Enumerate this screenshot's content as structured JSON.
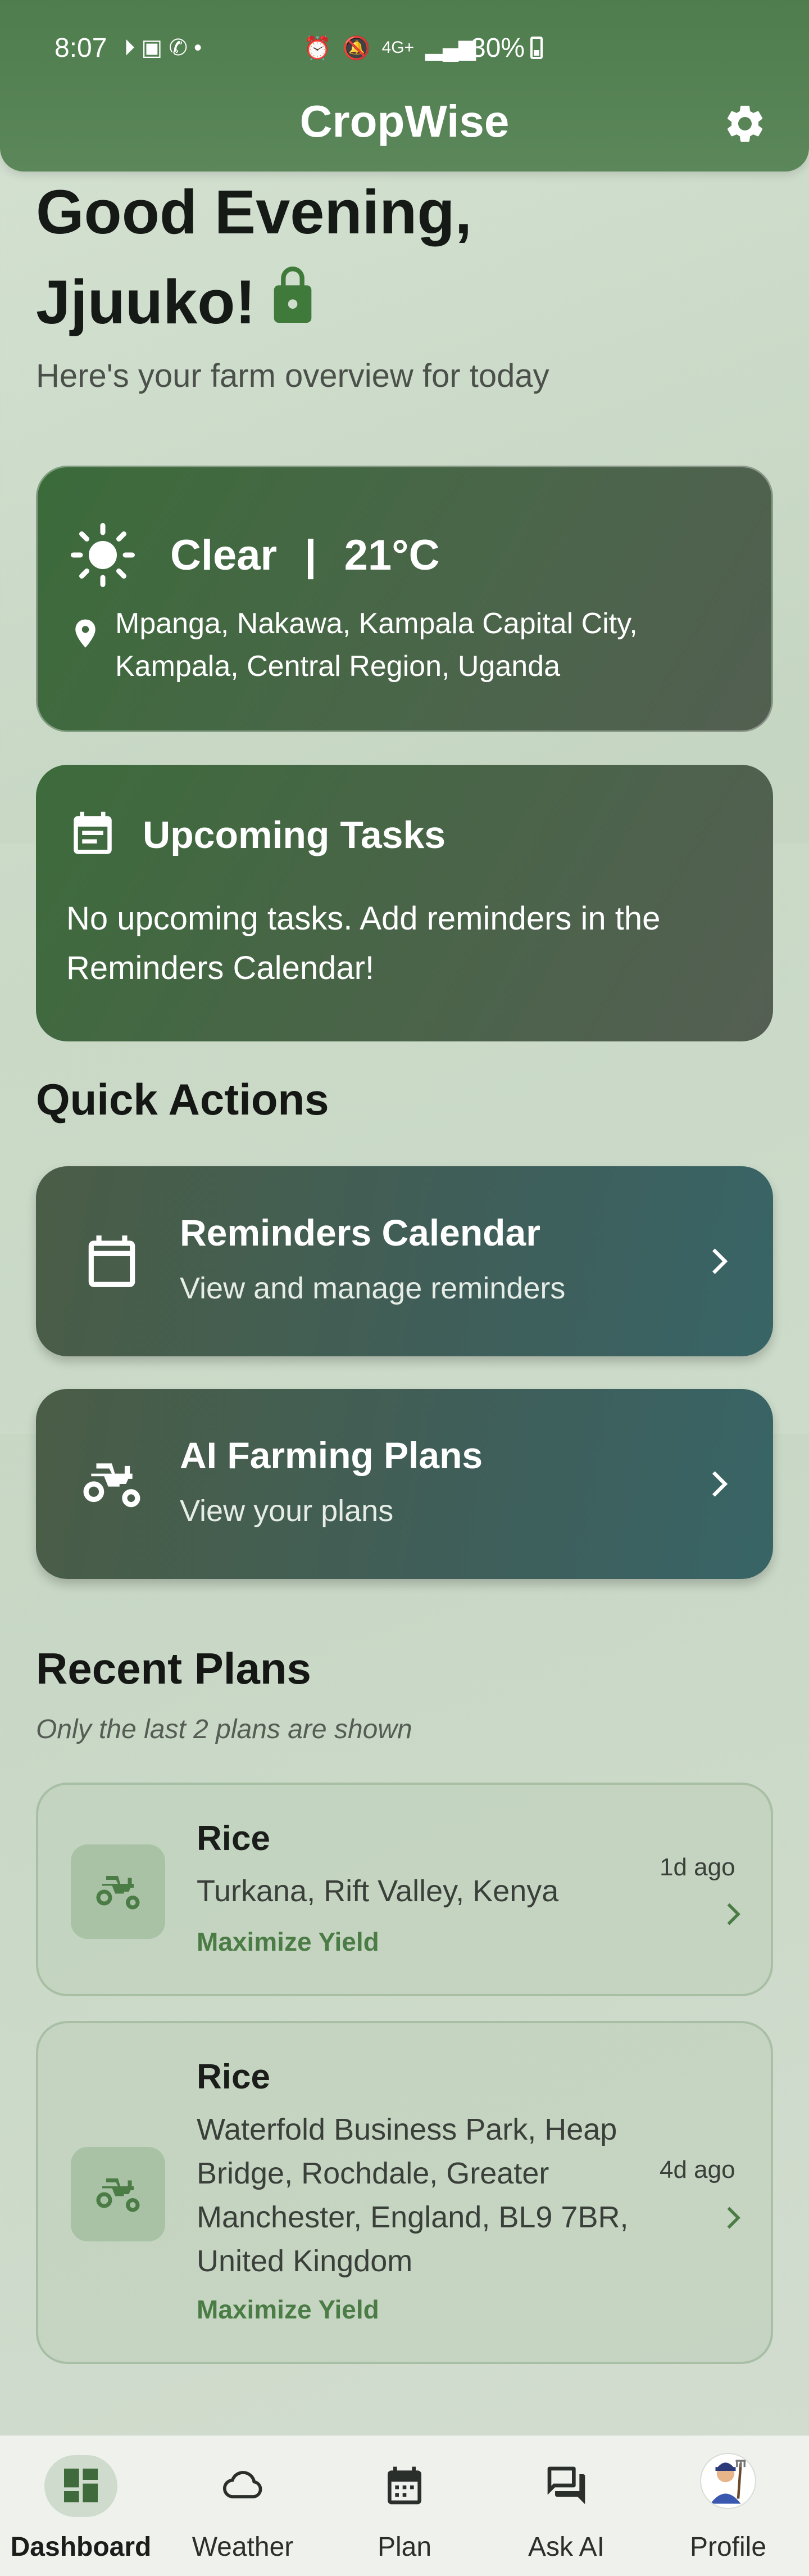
{
  "status_bar": {
    "time": "8:07",
    "network": "4G+",
    "battery": "30%"
  },
  "app": {
    "title": "CropWise"
  },
  "greeting": {
    "line1": "Good Evening,",
    "line2": "Jjuuko!",
    "subtitle": "Here's your farm overview for today"
  },
  "weather": {
    "condition": "Clear",
    "separator": "|",
    "temperature": "21°C",
    "location": "Mpanga, Nakawa, Kampala Capital City, Kampala, Central Region, Uganda"
  },
  "tasks": {
    "title": "Upcoming Tasks",
    "message": "No upcoming tasks. Add reminders in the Reminders Calendar!"
  },
  "quick_actions": {
    "title": "Quick Actions",
    "items": [
      {
        "title": "Reminders Calendar",
        "subtitle": "View and manage reminders",
        "icon": "calendar-icon"
      },
      {
        "title": "AI Farming Plans",
        "subtitle": "View your plans",
        "icon": "tractor-icon"
      }
    ]
  },
  "recent_plans": {
    "title": "Recent Plans",
    "hint": "Only the last 2 plans are shown",
    "items": [
      {
        "crop": "Rice",
        "location": "Turkana, Rift Valley, Kenya",
        "goal": "Maximize Yield",
        "time": "1d ago"
      },
      {
        "crop": "Rice",
        "location": "Waterfold Business Park, Heap Bridge, Rochdale, Greater Manchester, England, BL9 7BR, United Kingdom",
        "goal": "Maximize Yield",
        "time": "4d ago"
      }
    ]
  },
  "bottom_nav": {
    "items": [
      {
        "label": "Dashboard",
        "icon": "dashboard-icon",
        "active": true
      },
      {
        "label": "Weather",
        "icon": "cloud-icon",
        "active": false
      },
      {
        "label": "Plan",
        "icon": "calendar-icon",
        "active": false
      },
      {
        "label": "Ask AI",
        "icon": "chat-icon",
        "active": false
      },
      {
        "label": "Profile",
        "icon": "avatar",
        "active": false
      }
    ]
  },
  "colors": {
    "primary": "#4f7d4d",
    "accent_green": "#4b7c45",
    "teal": "#386466"
  }
}
